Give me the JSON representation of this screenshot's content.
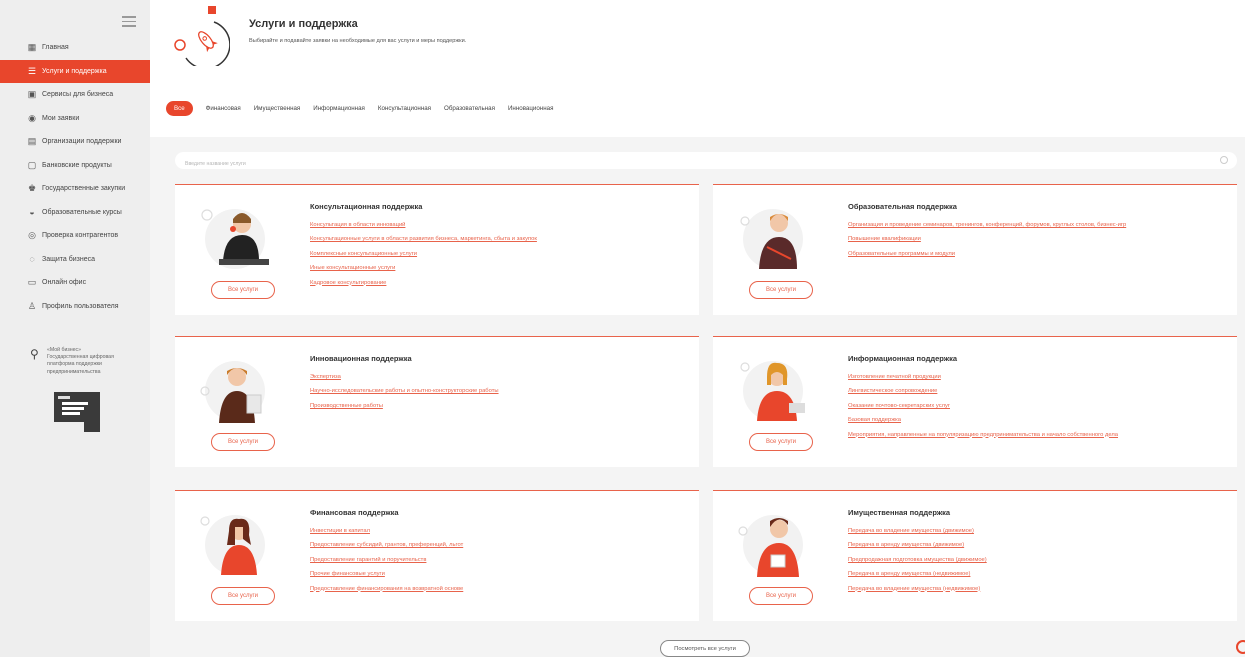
{
  "header": {
    "title": "Услуги и поддержка",
    "subtitle": "Выбирайте и подавайте заявки на необходимые для вас услуги и меры поддержки."
  },
  "sidebar": {
    "items": [
      {
        "label": "Главная",
        "icon": "grid-icon"
      },
      {
        "label": "Услуги и поддержка",
        "icon": "list-icon",
        "active": true
      },
      {
        "label": "Сервисы для бизнеса",
        "icon": "briefcase-icon"
      },
      {
        "label": "Мои заявки",
        "icon": "chat-icon"
      },
      {
        "label": "Организации поддержки",
        "icon": "building-icon"
      },
      {
        "label": "Банковские продукты",
        "icon": "wallet-icon"
      },
      {
        "label": "Государственные закупки",
        "icon": "emblem-icon"
      },
      {
        "label": "Образовательные курсы",
        "icon": "graduation-icon"
      },
      {
        "label": "Проверка контрагентов",
        "icon": "check-icon"
      },
      {
        "label": "Защита бизнеса",
        "icon": "shield-icon"
      },
      {
        "label": "Онлайн офис",
        "icon": "monitor-icon"
      },
      {
        "label": "Профиль пользователя",
        "icon": "user-icon"
      }
    ],
    "promo": {
      "brand": "«Мой бизнес»",
      "line1": "Государственная цифровая",
      "line2": "платформа поддержки",
      "line3": "предпринимательства"
    }
  },
  "tabs": [
    "Все",
    "Финансовая",
    "Имущественная",
    "Информационная",
    "Консультационная",
    "Образовательная",
    "Инновационная"
  ],
  "search": {
    "placeholder": "Введите название услуги"
  },
  "cards": [
    {
      "title": "Консультационная поддержка",
      "links": [
        "Консультация в области инноваций",
        "Консультационные услуги в области развития бизнеса, маркетинга, сбыта и закупок",
        "Комплексные консультационные услуги",
        "Иные консультационные услуги",
        "Кадровое консультирование"
      ],
      "button": "Все услуги"
    },
    {
      "title": "Образовательная поддержка",
      "links": [
        "Организация и проведение семинаров, тренингов, конференций, форумов, круглых столов, бизнес-игр",
        "Повышение квалификации",
        "Образовательные программы и модули"
      ],
      "button": "Все услуги"
    },
    {
      "title": "Инновационная поддержка",
      "links": [
        "Экспертиза",
        "Научно-исследовательские работы и опытно-конструкторские работы",
        "Производственные работы"
      ],
      "button": "Все услуги"
    },
    {
      "title": "Информационная поддержка",
      "links": [
        "Изготовление печатной продукции",
        "Лингвистическое сопровождение",
        "Оказание почтово-секретарских услуг",
        "Базовая поддержка",
        "Мероприятия, направленные на популяризацию предпринимательства и начало собственного дела"
      ],
      "button": "Все услуги"
    },
    {
      "title": "Финансовая поддержка",
      "links": [
        "Инвестиции в капитал",
        "Предоставление субсидий, грантов, преференций, льгот",
        "Предоставление гарантий и поручительств",
        "Прочие финансовые услуги",
        "Предоставление финансирования на возвратной основе"
      ],
      "button": "Все услуги"
    },
    {
      "title": "Имущественная поддержка",
      "links": [
        "Передача во владение имущества (движимое)",
        "Передача в аренду имущества (движимое)",
        "Предпродажная подготовка имущества (движимое)",
        "Передача в аренду имущества (недвижимое)",
        "Передача во владение имущества (недвижимое)"
      ],
      "button": "Все услуги"
    }
  ],
  "show_all": "Посмотреть все услуги",
  "colors": {
    "accent": "#e8462c",
    "link": "#e8634b",
    "sidebar_bg": "#eeeeee",
    "content_bg": "#f4f4f4"
  }
}
